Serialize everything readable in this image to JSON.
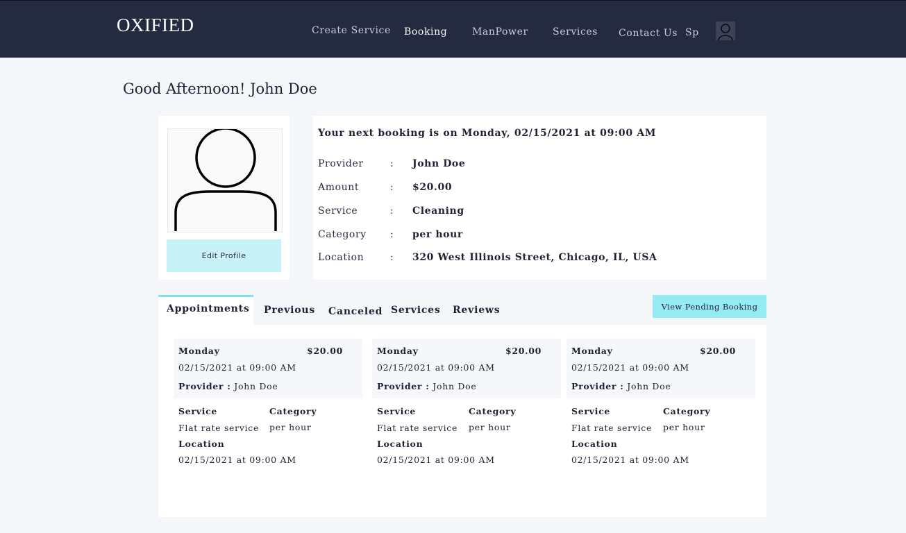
{
  "nav": {
    "logo": "OXIFIED",
    "items": [
      {
        "label": "Create Service"
      },
      {
        "label": "Booking"
      },
      {
        "label": "ManPower"
      },
      {
        "label": "Services"
      },
      {
        "label": "Contact Us"
      },
      {
        "label": "Sp"
      }
    ],
    "avatar_icon": "user-avatar-icon"
  },
  "greeting": "Good Afternoon! John Doe",
  "profile": {
    "image_icon": "user-silhouette-icon",
    "edit_label": "Edit Profile"
  },
  "next_booking": {
    "title": "Your next booking is on Monday, 02/15/2021 at 09:00 AM",
    "rows": [
      {
        "label": "Provider",
        "colon": ":",
        "value": "John Doe"
      },
      {
        "label": "Amount",
        "colon": ":",
        "value": "$20.00"
      },
      {
        "label": "Service",
        "colon": ":",
        "value": "Cleaning"
      },
      {
        "label": "Category",
        "colon": ":",
        "value": "per hour"
      },
      {
        "label": "Location",
        "colon": ":",
        "value": "320 West Illinois Street, Chicago, IL, USA"
      }
    ]
  },
  "tabs": [
    {
      "label": "Appointments"
    },
    {
      "label": "Previous"
    },
    {
      "label": "Canceled"
    },
    {
      "label": "Services"
    },
    {
      "label": "Reviews"
    }
  ],
  "pending_button": "View Pending Booking",
  "appointments": [
    {
      "day": "Monday",
      "price": "$20.00",
      "date": "02/15/2021 at 09:00 AM",
      "provider_label": "Provider :",
      "provider": " John Doe",
      "service_label": "Service",
      "service": "Flat rate service",
      "category_label": "Category",
      "category": "per hour",
      "location_label": "Location",
      "location": "02/15/2021 at 09:00 AM"
    },
    {
      "day": "Monday",
      "price": "$20.00",
      "date": "02/15/2021 at 09:00 AM",
      "provider_label": "Provider :",
      "provider": " John Doe",
      "service_label": "Service",
      "service": "Flat rate service",
      "category_label": "Category",
      "category": "per hour",
      "location_label": "Location",
      "location": "02/15/2021 at 09:00 AM"
    },
    {
      "day": "Monday",
      "price": "$20.00",
      "date": "02/15/2021 at 09:00 AM",
      "provider_label": "Provider :",
      "provider": " John Doe",
      "service_label": "Service",
      "service": "Flat rate service",
      "category_label": "Category",
      "category": "per hour",
      "location_label": "Location",
      "location": "02/15/2021 at 09:00 AM"
    }
  ]
}
